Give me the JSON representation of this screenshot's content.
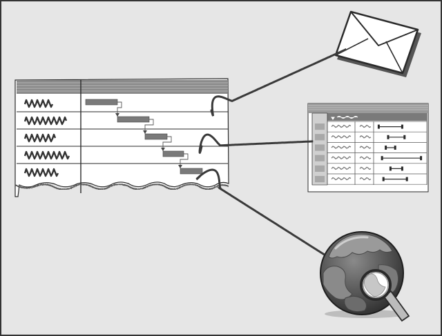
{
  "colors": {
    "background": "#e6e6e6",
    "frame": "#333333",
    "paper": "#ffffff",
    "header_gray": "#8a8a8a",
    "bar_gray": "#7a7a7a",
    "dark": "#2a2a2a",
    "globe_dark": "#3c3c3c",
    "globe_mid": "#6c6c6c",
    "globe_light": "#9a9a9a"
  },
  "icons": {
    "envelope": "envelope-icon",
    "globe": "globe-icon",
    "magnifier": "magnifying-glass-icon"
  },
  "gantt": {
    "row_count": 5,
    "task_count": 5
  },
  "table": {
    "row_count": 6,
    "range_bars": [
      [
        0.05,
        0.55
      ],
      [
        0.25,
        0.6
      ],
      [
        0.2,
        0.4
      ],
      [
        0.12,
        0.95
      ],
      [
        0.3,
        0.55
      ],
      [
        0.15,
        0.65
      ]
    ]
  }
}
